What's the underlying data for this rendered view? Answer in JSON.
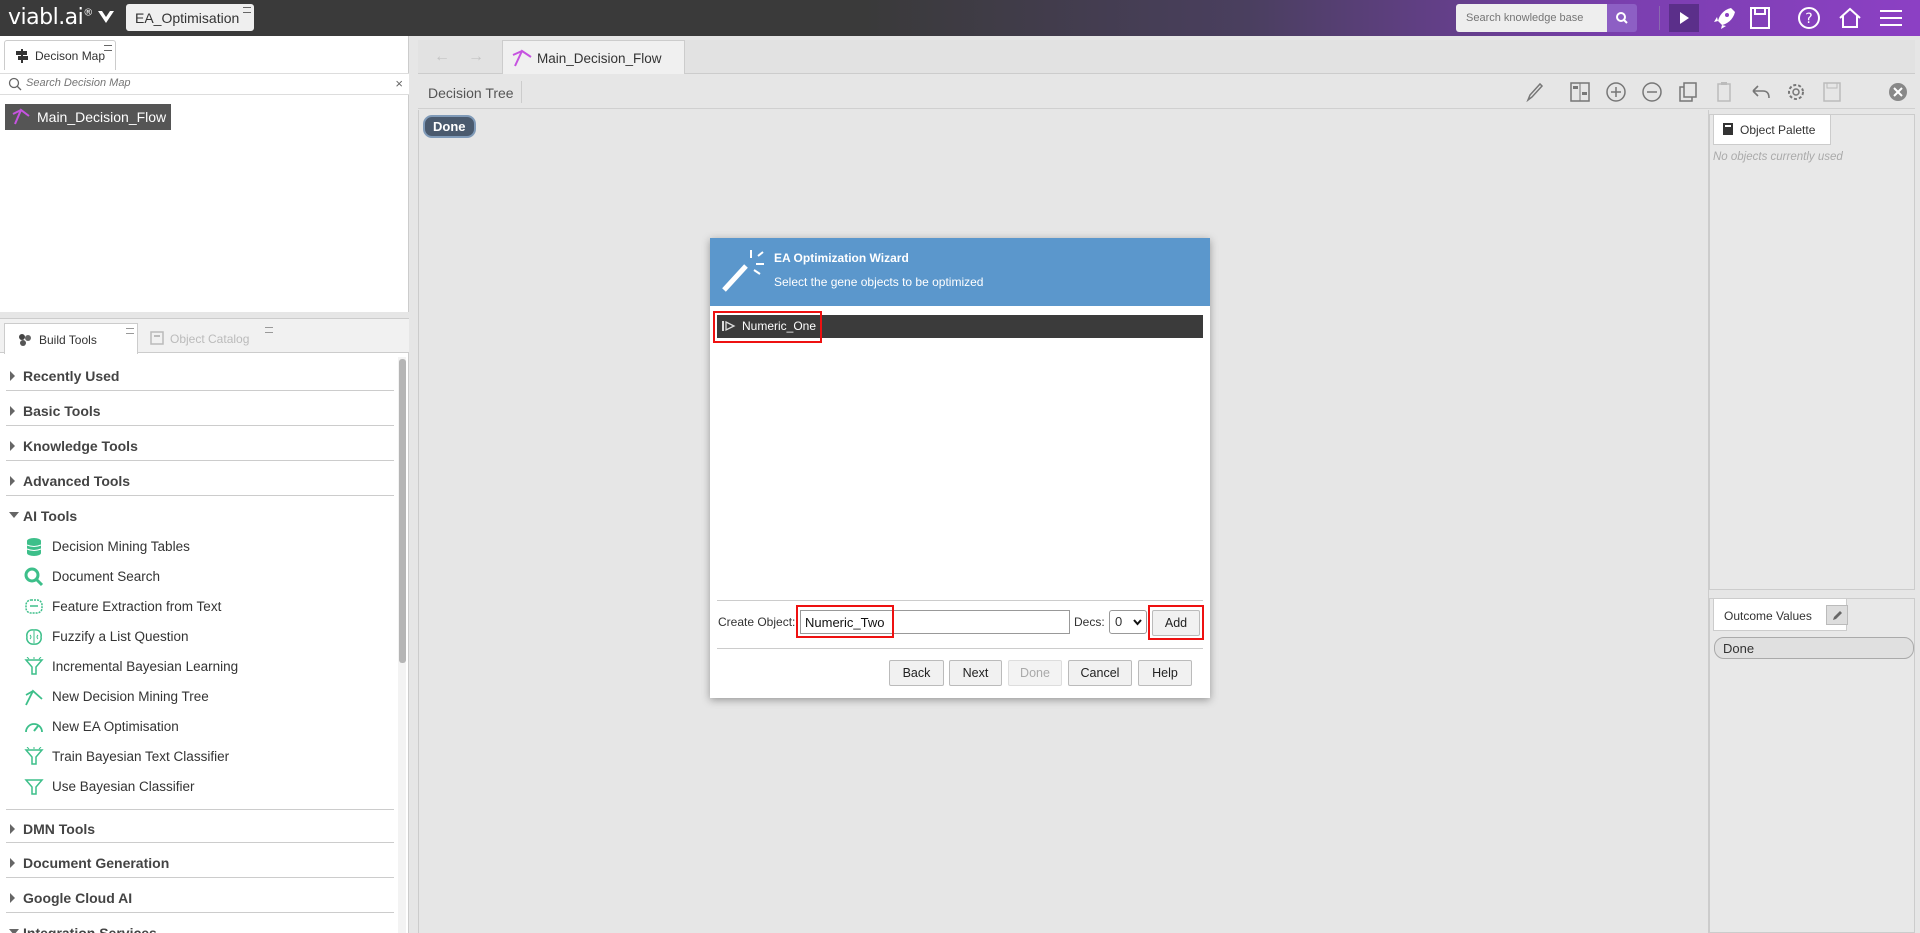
{
  "topbar": {
    "logo_text": "viabl.ai",
    "logo_mark": "®",
    "kb_tab_label": "EA_Optimisation",
    "search_placeholder": "Search knowledge base",
    "icons": [
      "run-icon",
      "rocket-icon",
      "save-icon",
      "help-icon",
      "home-icon",
      "menu-icon"
    ]
  },
  "decision_map": {
    "tab_label": "Decison Map",
    "search_placeholder": "Search Decision Map",
    "items": [
      {
        "label": "Main_Decision_Flow"
      }
    ]
  },
  "tools_panel": {
    "tabs": [
      "Build Tools",
      "Object Catalog"
    ],
    "categories": {
      "recently_used": "Recently Used",
      "basic": "Basic Tools",
      "knowledge": "Knowledge Tools",
      "advanced": "Advanced Tools",
      "ai": "AI Tools",
      "dmn": "DMN Tools",
      "docgen": "Document Generation",
      "gcloud": "Google Cloud AI",
      "integration": "Integration Services"
    },
    "ai_tools": [
      "Decision Mining Tables",
      "Document Search",
      "Feature Extraction from Text",
      "Fuzzify a List Question",
      "Incremental Bayesian Learning",
      "New Decision Mining Tree",
      "New EA Optimisation",
      "Train Bayesian Text Classifier",
      "Use Bayesian Classifier"
    ]
  },
  "editor": {
    "tab_label": "Main_Decision_Flow",
    "toolbar_label": "Decision Tree",
    "node_label": "Done"
  },
  "object_palette": {
    "tab_label": "Object Palette",
    "empty_text": "No objects currently used"
  },
  "outcome_values": {
    "tab_label": "Outcome Values",
    "items": [
      "Done"
    ]
  },
  "wizard": {
    "title": "EA Optimization Wizard",
    "subtitle": "Select the gene objects to be optimized",
    "genes": [
      "Numeric_One"
    ],
    "create_label": "Create Object:",
    "create_value": "Numeric_Two",
    "decs_label": "Decs:",
    "decs_value": "0",
    "buttons": {
      "add": "Add",
      "back": "Back",
      "next": "Next",
      "done": "Done",
      "cancel": "Cancel",
      "help": "Help"
    }
  },
  "colors": {
    "accent_purple": "#8d5fc4",
    "dialog_header": "#5b97cc",
    "highlight_red": "#e11111",
    "tool_icon_green": "#3dbf8a"
  }
}
